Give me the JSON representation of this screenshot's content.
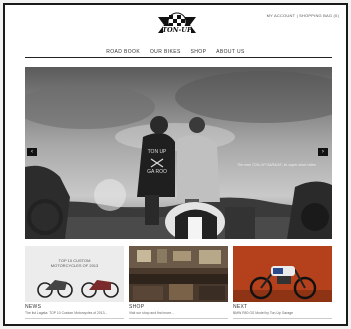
{
  "header": {
    "logo_text": "TON-UP",
    "account_link": "MY ACCOUNT",
    "separator": "|",
    "cart_link": "SHOPPING BAG (0)"
  },
  "nav": {
    "items": [
      {
        "label": "ROAD BOOK"
      },
      {
        "label": "OUR BIKES"
      },
      {
        "label": "SHOP"
      },
      {
        "label": "ABOUT US"
      }
    ]
  },
  "hero": {
    "caption": "The new TON-UP GARAGE, its super short video",
    "jacket_text_1": "TON UP",
    "jacket_text_2": "GA ROO",
    "prev_label": "‹",
    "next_label": "›"
  },
  "cards": [
    {
      "category": "NEWS",
      "description": "The list Lagata: TOP 10 Custom Motorcycles of 2013...",
      "tile_text_1": "TOP 10 CUSTOM",
      "tile_text_2": "MOTORCYCLES OF 2013"
    },
    {
      "category": "SHOP",
      "description": "Visit our shop and find more...",
      "tile_text_1": "",
      "tile_text_2": ""
    },
    {
      "category": "NEXT",
      "description": "BMW R80 GS Model by Ton-Up Garage",
      "tile_text_1": "",
      "tile_text_2": ""
    }
  ],
  "colors": {
    "frame": "#1a1a1a",
    "background": "#f2f2f2",
    "hero_sky": "#9a9a9a",
    "bike_red": "#b5401c"
  }
}
